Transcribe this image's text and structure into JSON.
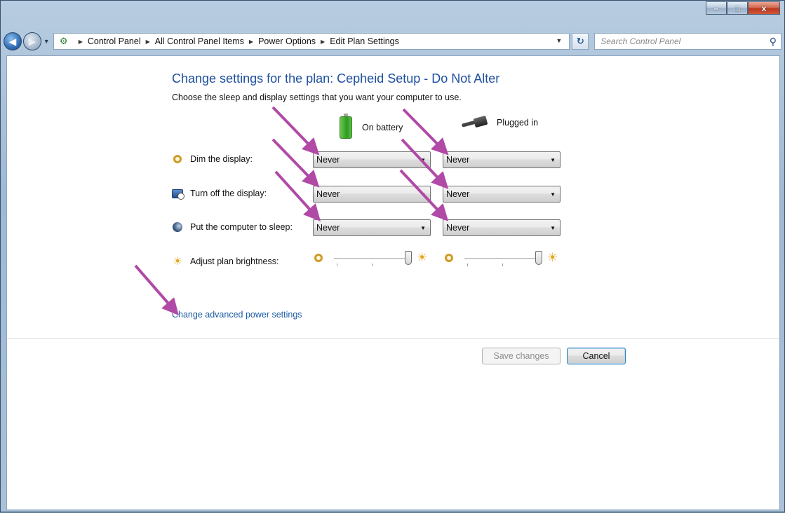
{
  "window": {
    "minimize_glyph": "–",
    "maximize_glyph": "□",
    "close_glyph": "x"
  },
  "nav": {
    "breadcrumbs": [
      "Control Panel",
      "All Control Panel Items",
      "Power Options",
      "Edit Plan Settings"
    ],
    "search_placeholder": "Search Control Panel"
  },
  "page": {
    "heading": "Change settings for the plan: Cepheid Setup - Do Not Alter",
    "subheading": "Choose the sleep and display settings that you want your computer to use.",
    "col_battery": "On battery",
    "col_plugged": "Plugged in"
  },
  "settings": [
    {
      "label": "Dim the display:",
      "icon": "dim-display-icon",
      "battery": "Never",
      "plugged": "Never"
    },
    {
      "label": "Turn off the display:",
      "icon": "monitor-clock-icon",
      "battery": "Never",
      "plugged": "Never"
    },
    {
      "label": "Put the computer to sleep:",
      "icon": "moon-icon",
      "battery": "Never",
      "plugged": "Never"
    }
  ],
  "brightness": {
    "label": "Adjust plan brightness:",
    "battery_level": 1.0,
    "plugged_level": 1.0
  },
  "advanced_link": "Change advanced power settings",
  "buttons": {
    "save": "Save changes",
    "cancel": "Cancel"
  },
  "colors": {
    "heading": "#1d4f9e",
    "link": "#1c5aa3",
    "annotation_arrow": "#b04aa6"
  }
}
